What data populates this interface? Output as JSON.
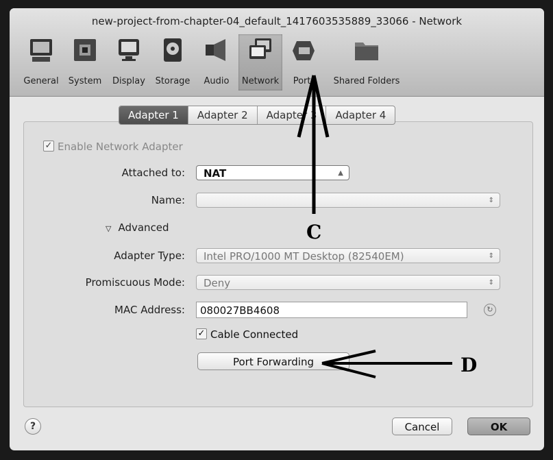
{
  "window": {
    "title": "new-project-from-chapter-04_default_1417603535889_33066 - Network"
  },
  "toolbar": {
    "items": [
      {
        "label": "General",
        "icon": "monitor-icon"
      },
      {
        "label": "System",
        "icon": "chip-icon"
      },
      {
        "label": "Display",
        "icon": "display-icon"
      },
      {
        "label": "Storage",
        "icon": "disk-icon"
      },
      {
        "label": "Audio",
        "icon": "speaker-icon"
      },
      {
        "label": "Network",
        "icon": "network-icon",
        "selected": true
      },
      {
        "label": "Ports",
        "icon": "plug-icon"
      },
      {
        "label": "Shared Folders",
        "icon": "folder-icon"
      }
    ]
  },
  "tabs": [
    "Adapter 1",
    "Adapter 2",
    "Adapter 3",
    "Adapter 4"
  ],
  "form": {
    "enable_adapter": "Enable Network Adapter",
    "attached_label": "Attached to:",
    "attached_value": "NAT",
    "name_label": "Name:",
    "name_value": "",
    "advanced": "Advanced",
    "adapter_type_label": "Adapter Type:",
    "adapter_type_value": "Intel PRO/1000 MT Desktop (82540EM)",
    "promisc_label": "Promiscuous Mode:",
    "promisc_value": "Deny",
    "mac_label": "MAC Address:",
    "mac_value": "080027BB4608",
    "cable_connected": "Cable Connected",
    "port_forwarding": "Port Forwarding"
  },
  "footer": {
    "help": "?",
    "cancel": "Cancel",
    "ok": "OK"
  },
  "annotations": {
    "c": "C",
    "d": "D"
  }
}
